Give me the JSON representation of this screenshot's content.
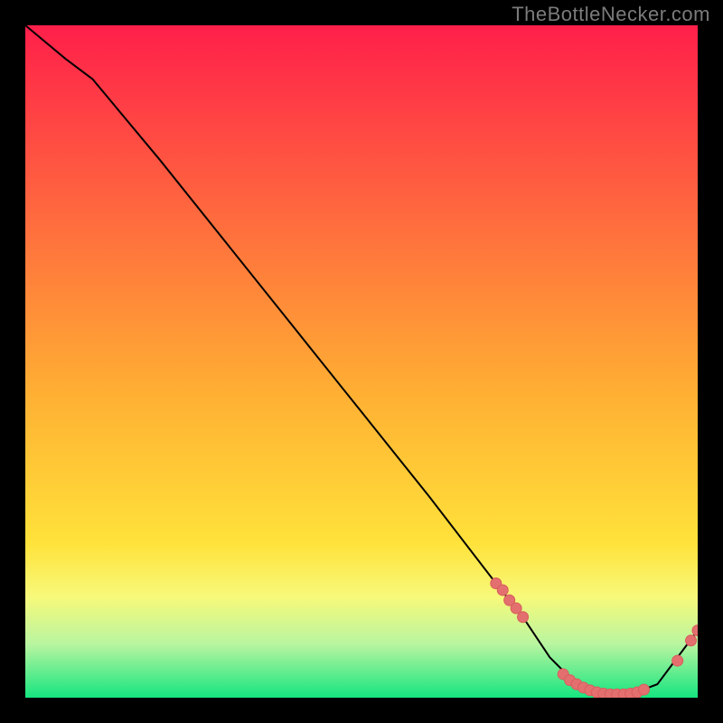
{
  "attribution": "TheBottleNecker.com",
  "colors": {
    "page_bg": "#000000",
    "grad_top": "#ff1f4a",
    "grad_yellow": "#ffe23a",
    "grad_green_light": "#b9f5a0",
    "grad_green": "#15e57f",
    "line": "#000000",
    "marker": "#e46f6f",
    "marker_stroke": "#d85d5d",
    "attr_text": "#7b7b7b"
  },
  "chart_data": {
    "type": "line",
    "title": "",
    "xlabel": "",
    "ylabel": "",
    "xlim": [
      0,
      100
    ],
    "ylim": [
      0,
      100
    ],
    "x": [
      0,
      6,
      10,
      20,
      30,
      40,
      50,
      60,
      70,
      74,
      78,
      82,
      86,
      90,
      94,
      100
    ],
    "y": [
      100,
      95,
      92,
      80,
      67.5,
      55,
      42.5,
      30,
      17,
      12,
      6,
      2,
      0.5,
      0.5,
      2,
      10
    ],
    "markers": [
      {
        "x": 70.0,
        "y": 17.0
      },
      {
        "x": 71.0,
        "y": 16.0
      },
      {
        "x": 72.0,
        "y": 14.5
      },
      {
        "x": 73.0,
        "y": 13.3
      },
      {
        "x": 74.0,
        "y": 12.0
      },
      {
        "x": 80.0,
        "y": 3.5
      },
      {
        "x": 81.0,
        "y": 2.6
      },
      {
        "x": 82.0,
        "y": 2.0
      },
      {
        "x": 83.0,
        "y": 1.5
      },
      {
        "x": 84.0,
        "y": 1.1
      },
      {
        "x": 85.0,
        "y": 0.8
      },
      {
        "x": 86.0,
        "y": 0.6
      },
      {
        "x": 87.0,
        "y": 0.5
      },
      {
        "x": 88.0,
        "y": 0.5
      },
      {
        "x": 89.0,
        "y": 0.5
      },
      {
        "x": 90.0,
        "y": 0.6
      },
      {
        "x": 91.0,
        "y": 0.8
      },
      {
        "x": 92.0,
        "y": 1.2
      },
      {
        "x": 97.0,
        "y": 5.5
      },
      {
        "x": 99.0,
        "y": 8.5
      },
      {
        "x": 100.0,
        "y": 10.0
      }
    ]
  }
}
